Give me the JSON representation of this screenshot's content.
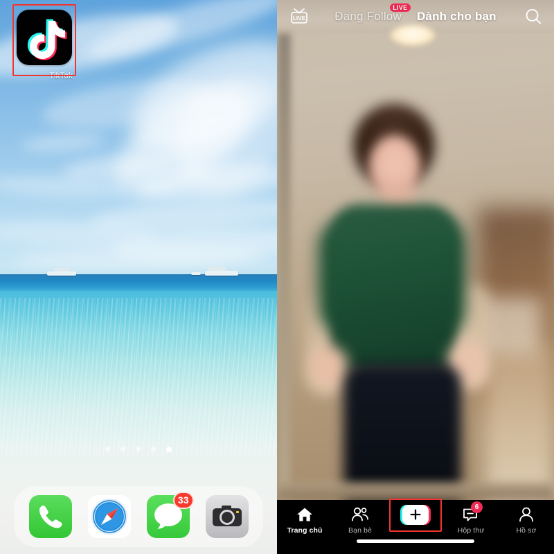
{
  "home_screen": {
    "app": {
      "name": "TikTok",
      "icon": "tiktok-icon",
      "highlighted": true,
      "highlight_color": "#f4352f"
    },
    "page_dots": {
      "count": 5,
      "active_index": 4
    },
    "dock": {
      "items": [
        {
          "name": "Phone",
          "icon": "phone-icon",
          "badge": null
        },
        {
          "name": "Safari",
          "icon": "compass-icon",
          "badge": null
        },
        {
          "name": "Messages",
          "icon": "message-bubble-icon",
          "badge": "33"
        },
        {
          "name": "Camera",
          "icon": "camera-icon",
          "badge": null
        }
      ]
    }
  },
  "tiktok_app": {
    "top_bar": {
      "live_icon": "live-tv-icon",
      "tabs": [
        {
          "label": "Đang Follow",
          "active": false,
          "badge": "LIVE"
        },
        {
          "label": "Dành cho bạn",
          "active": true,
          "badge": null
        }
      ],
      "search_icon": "search-icon"
    },
    "bottom_nav": {
      "items": [
        {
          "label": "Trang chủ",
          "icon": "home-icon",
          "active": true,
          "badge": null
        },
        {
          "label": "Bạn bè",
          "icon": "friends-icon",
          "active": false,
          "badge": null
        },
        {
          "label": "",
          "icon": "create-plus-icon",
          "active": false,
          "badge": null,
          "highlighted": true
        },
        {
          "label": "Hộp thư",
          "icon": "inbox-icon",
          "active": false,
          "badge": "6"
        },
        {
          "label": "Hồ sơ",
          "icon": "profile-icon",
          "active": false,
          "badge": null
        }
      ]
    },
    "colors": {
      "accent_pink": "#fe2c55",
      "accent_cyan": "#25f4ee",
      "badge_red": "#f02c56",
      "highlight_red": "#f4352f"
    }
  }
}
